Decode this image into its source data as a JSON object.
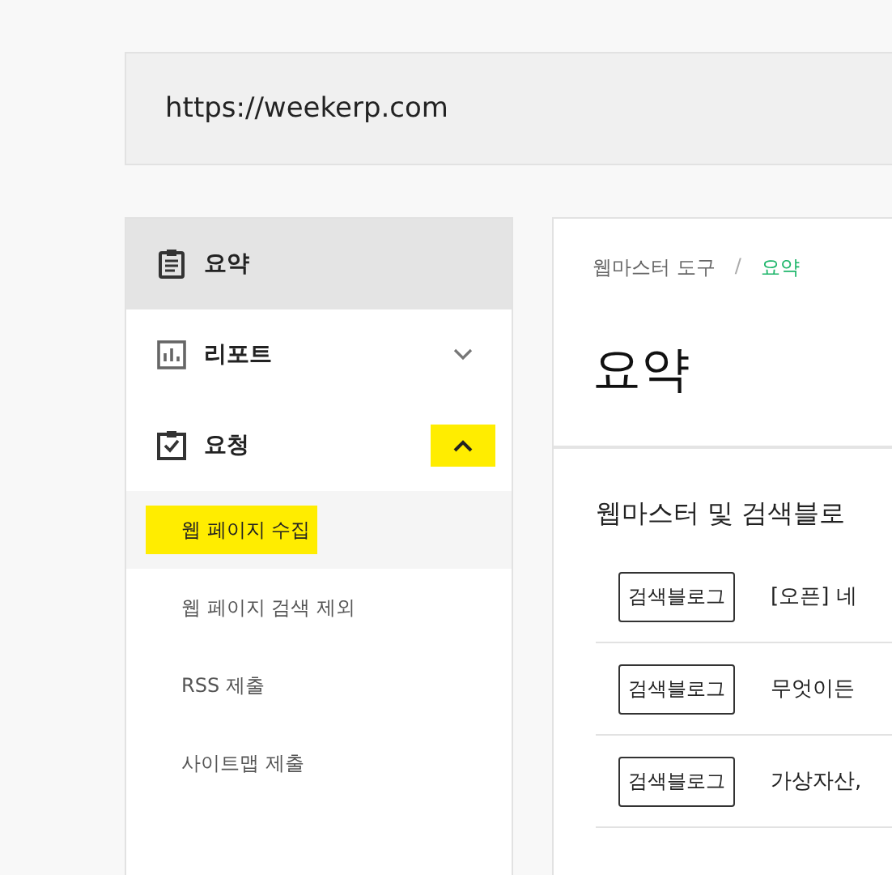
{
  "address_bar": {
    "url": "https://weekerp.com"
  },
  "sidebar": {
    "items": [
      {
        "label": "요약",
        "kind": "summary",
        "selected": true
      },
      {
        "label": "리포트",
        "kind": "report",
        "selected": false,
        "expanded": false,
        "highlighted": false
      },
      {
        "label": "요청",
        "kind": "request",
        "selected": false,
        "expanded": true,
        "highlighted": true,
        "children": [
          {
            "label": "웹 페이지 수집",
            "selected": true,
            "highlighted": true
          },
          {
            "label": "웹 페이지 검색 제외",
            "selected": false,
            "highlighted": false
          },
          {
            "label": "RSS 제출",
            "selected": false,
            "highlighted": false
          },
          {
            "label": "사이트맵 제출",
            "selected": false,
            "highlighted": false
          }
        ]
      }
    ]
  },
  "breadcrumb": {
    "items": [
      "웹마스터 도구",
      "요약"
    ],
    "separator": "/"
  },
  "page_title": "요약",
  "section": {
    "title": "웹마스터 및 검색블로",
    "rows": [
      {
        "tag": "검색블로그",
        "text": "[오픈] 네"
      },
      {
        "tag": "검색블로그",
        "text": "무엇이든"
      },
      {
        "tag": "검색블로그",
        "text": "가상자산,"
      }
    ]
  }
}
